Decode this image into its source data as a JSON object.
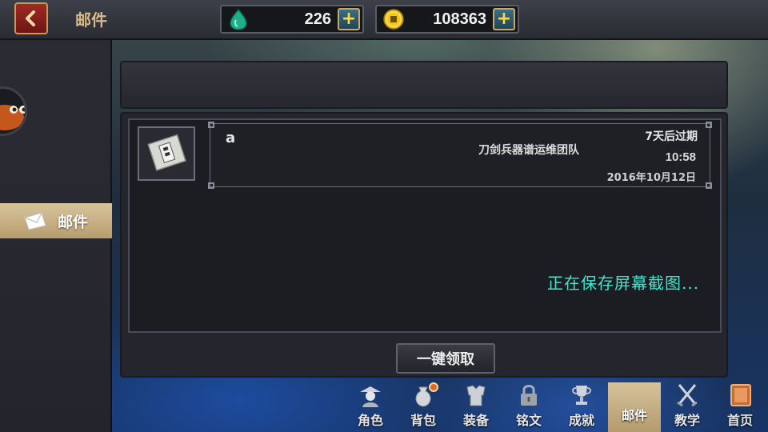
{
  "header": {
    "title": "邮件",
    "jade": {
      "icon": "jade-drop-icon",
      "amount": "226"
    },
    "coins": {
      "icon": "gold-coin-icon",
      "amount": "108363"
    },
    "plus_symbol": "+"
  },
  "sidebar": {
    "items": [
      {
        "label": "邮件",
        "icon": "envelope-icon",
        "active": true
      }
    ]
  },
  "mail": {
    "sender": "a",
    "subject": "刀剑兵器谱运维团队",
    "expire": "7天后过期",
    "time": "10:58",
    "date": "2016年10月12日",
    "icon": "letter-scroll-icon"
  },
  "overlay": {
    "saving": "正在保存屏幕截图..."
  },
  "actions": {
    "collect_all": "一键领取"
  },
  "bottom_nav": {
    "items": [
      {
        "label": "角色",
        "icon": "character-icon"
      },
      {
        "label": "背包",
        "icon": "bag-icon",
        "badge": true
      },
      {
        "label": "装备",
        "icon": "armor-icon"
      },
      {
        "label": "铭文",
        "icon": "lock-icon"
      },
      {
        "label": "成就",
        "icon": "trophy-icon"
      },
      {
        "label": "邮件",
        "icon": "mail-tab",
        "active": true
      },
      {
        "label": "教学",
        "icon": "crossed-swords-icon"
      },
      {
        "label": "首页",
        "icon": "home-scroll-icon"
      }
    ]
  },
  "colors": {
    "accent_gold": "#d9b98a",
    "active_tab": "#d6c29b",
    "saving_text": "#3fe6cf",
    "notification_dot": "#e8641f"
  }
}
